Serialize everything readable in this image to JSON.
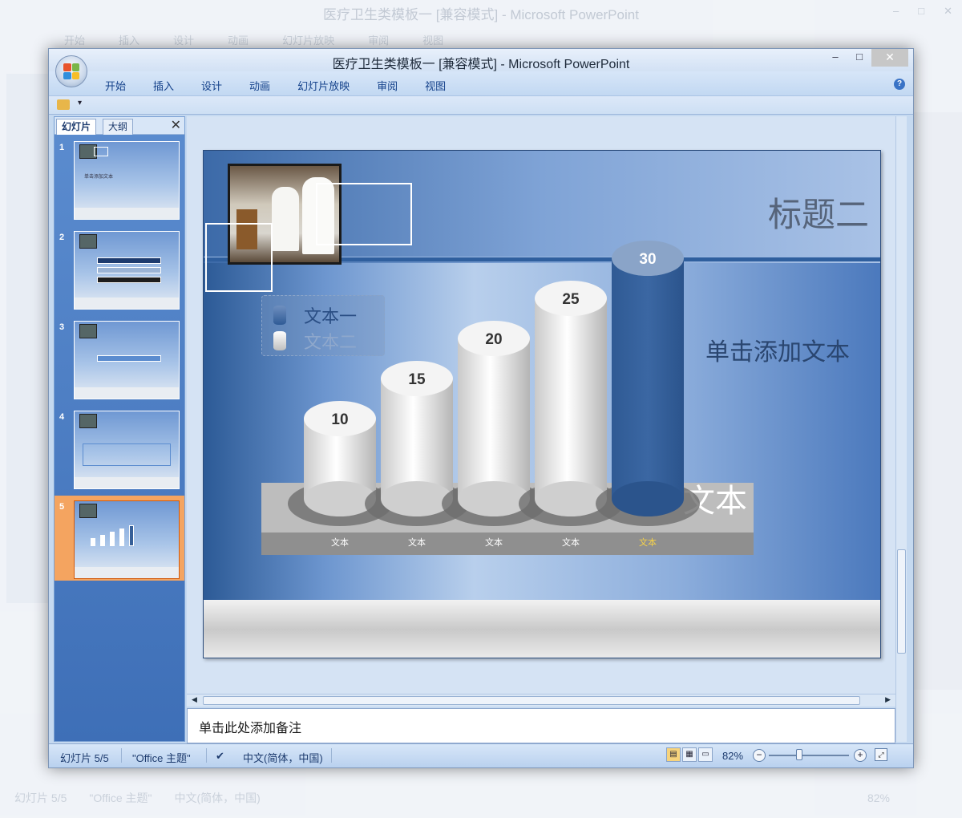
{
  "background": {
    "title": "医疗卫生类模板一 [兼容模式] - Microsoft PowerPoint",
    "menu": [
      "开始",
      "插入",
      "设计",
      "动画",
      "幻灯片放映",
      "审阅",
      "视图"
    ],
    "status_slide": "幻灯片 5/5",
    "status_theme": "\"Office 主题\"",
    "status_lang": "中文(简体，中国)",
    "status_zoom": "82%"
  },
  "window": {
    "title": "医疗卫生类模板一 [兼容模式] - Microsoft PowerPoint",
    "controls": {
      "minimize": "‒",
      "maximize": "□",
      "close": "✕"
    }
  },
  "ribbon": {
    "tabs": [
      {
        "label": "开始"
      },
      {
        "label": "插入"
      },
      {
        "label": "设计"
      },
      {
        "label": "动画"
      },
      {
        "label": "幻灯片放映"
      },
      {
        "label": "审阅"
      },
      {
        "label": "视图"
      }
    ],
    "help": "?"
  },
  "slides_panel": {
    "tab_slides": "幻灯片",
    "tab_outline": "大纲",
    "close": "✕",
    "thumbs": [
      {
        "num": "1",
        "text": "单击添加文本"
      },
      {
        "num": "2",
        "text": ""
      },
      {
        "num": "3",
        "text": ""
      },
      {
        "num": "4",
        "text": ""
      },
      {
        "num": "5",
        "text": ""
      }
    ],
    "selected_index": 5
  },
  "slide": {
    "title": "标题二",
    "subtitle": "单击添加文本",
    "legend": [
      "文本一",
      "文本二"
    ],
    "base_label": "文本",
    "colors": {
      "accent": "#365f98",
      "pillar": "#e6e6e6"
    }
  },
  "chart_data": {
    "type": "bar",
    "categories": [
      "文本",
      "文本",
      "文本",
      "文本",
      "文本"
    ],
    "series": [
      {
        "name": "文本一",
        "values": [
          null,
          null,
          null,
          null,
          30
        ]
      },
      {
        "name": "文本二",
        "values": [
          10,
          15,
          20,
          25,
          null
        ]
      }
    ],
    "values": [
      10,
      15,
      20,
      25,
      30
    ],
    "title": "",
    "xlabel": "",
    "ylabel": "",
    "ylim": [
      0,
      30
    ],
    "grid": false,
    "legend": "top-left"
  },
  "notes": {
    "placeholder": "单击此处添加备注"
  },
  "statusbar": {
    "slide": "幻灯片 5/5",
    "theme": "\"Office 主题\"",
    "language": "中文(简体，中国)",
    "zoom": "82%"
  }
}
